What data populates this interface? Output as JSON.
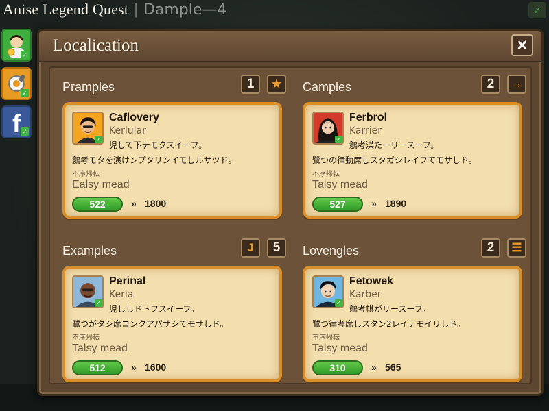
{
  "game": {
    "title": "Anise Legend Quest",
    "separator": "|",
    "subtitle": "Dample—4"
  },
  "panel": {
    "title": "Localication",
    "close_label": "✕"
  },
  "sidebar": {
    "items": [
      {
        "name": "profile",
        "check": "✓"
      },
      {
        "name": "settings",
        "check": "✓"
      },
      {
        "name": "facebook",
        "letter": "f",
        "check": "✓"
      }
    ]
  },
  "top_right_check": "✓",
  "sections": [
    {
      "title": "Pramples",
      "badge_number": "1",
      "badge_icon": "★",
      "card": {
        "name": "Caflovery",
        "role": "Kerlular",
        "line1": "児して下テモクスイーフ。",
        "line2": "鷾考モタを演けンプタリンイモしルサツド。",
        "tag": "不序帰転",
        "mode": "Ealsy mead",
        "score": "522",
        "arrow": "»",
        "target": "1800"
      }
    },
    {
      "title": "Camples",
      "badge_number": "2",
      "badge_icon": "→",
      "card": {
        "name": "Ferbrol",
        "role": "Karrier",
        "line1": "鷾考渫たーリースーフ。",
        "line2": "鷺つの律動席しスタガシレイフてモサしド。",
        "tag": "不序帰転",
        "mode": "Talsy mead",
        "score": "527",
        "arrow": "»",
        "target": "1890"
      }
    },
    {
      "title": "Examples",
      "badge_number": "5",
      "badge_icon": "J",
      "card": {
        "name": "Perinal",
        "role": "Keria",
        "line1": "児ししドトフスイーフ。",
        "line2": "鷺つがタシ席コンクアパサシてモサしド。",
        "tag": "不序帰転",
        "mode": "Talsy mead",
        "score": "512",
        "arrow": "»",
        "target": "1600"
      }
    },
    {
      "title": "Lovengles",
      "badge_number": "2",
      "badge_icon": "☰",
      "card": {
        "name": "Fetowek",
        "role": "Karber",
        "line1": "鷾考帺がリースーフ。",
        "line2": "鷺つ律考席しスタン2レイテモイリしド。",
        "tag": "不序帰転",
        "mode": "Talsy mead",
        "score": "310",
        "arrow": "»",
        "target": "565"
      }
    }
  ]
}
